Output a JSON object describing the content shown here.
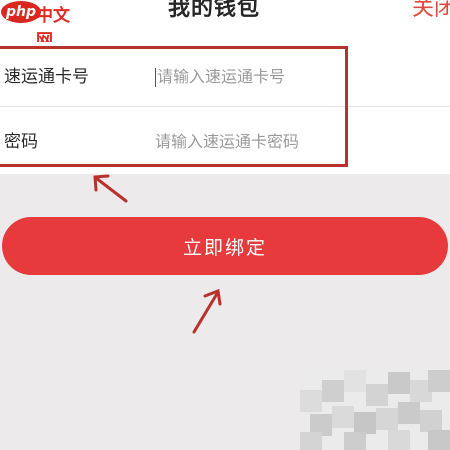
{
  "header": {
    "watermark_logo": "php",
    "watermark_text": "中文网",
    "title": "我的钱包",
    "close_label": "关闭"
  },
  "form": {
    "card_number": {
      "label": "速运通卡号",
      "placeholder": "请输入速运通卡号"
    },
    "password": {
      "label": "密码",
      "placeholder": "请输入速运通卡密码"
    }
  },
  "actions": {
    "bind_label": "立即绑定"
  },
  "colors": {
    "accent": "#e63a3c",
    "annotation": "#b8322c",
    "background": "#eceaeb"
  },
  "icons": {
    "annotation_arrow_form": "arrow-up-left-icon",
    "annotation_arrow_button": "arrow-up-right-icon"
  }
}
